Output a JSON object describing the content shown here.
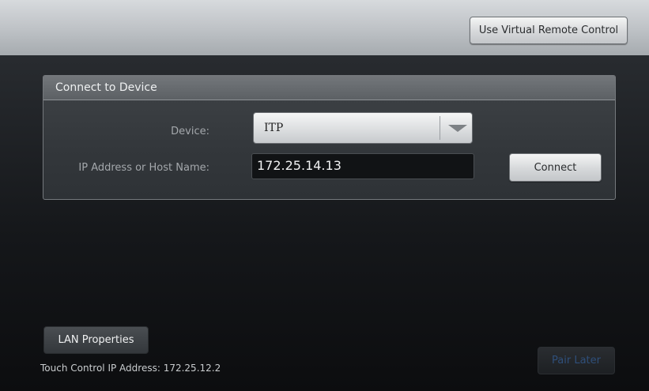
{
  "topbar": {
    "virtual_remote_label": "Use Virtual Remote Control"
  },
  "panel": {
    "title": "Connect to Device",
    "device_label": "Device:",
    "device_value": "ITP",
    "ip_label": "IP Address or Host Name:",
    "ip_value": "172.25.14.13",
    "connect_label": "Connect"
  },
  "footer": {
    "lan_label": "LAN Properties",
    "touch_ip_label": "Touch Control IP Address:",
    "touch_ip_value": "172.25.12.2",
    "pair_later_label": "Pair Later"
  },
  "colors": {
    "disabled_text": "#2f4f7a",
    "label_text": "#a4a8ac"
  },
  "icons": {
    "dropdown": "chevron-down-icon"
  }
}
